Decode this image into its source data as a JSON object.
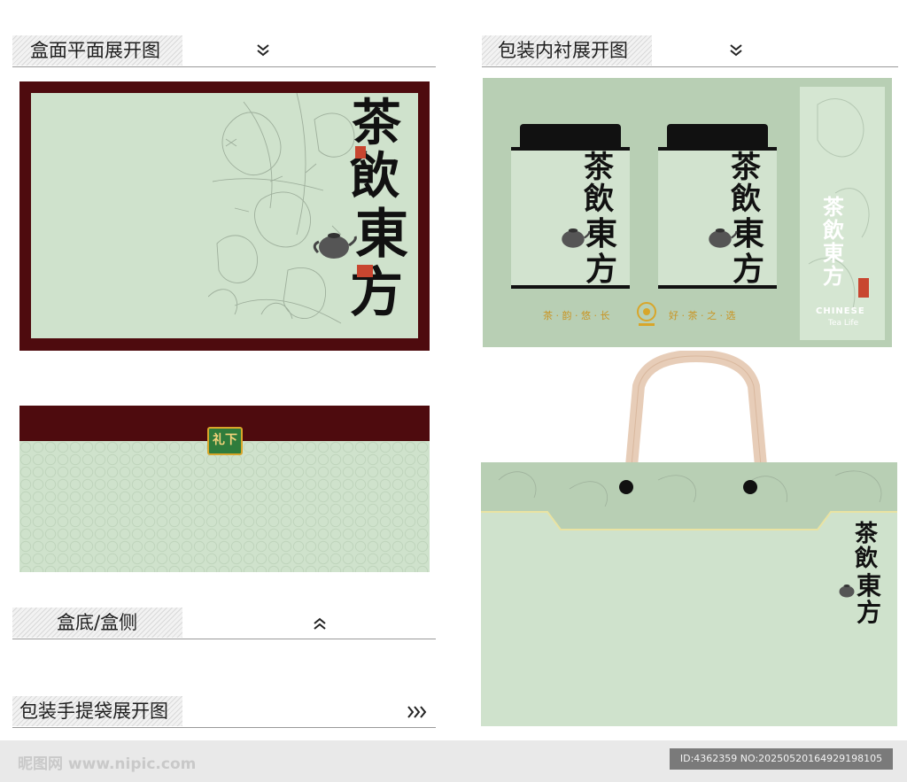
{
  "sections": {
    "box_top": {
      "title": "盒面平面展开图",
      "toggle_icon": "chevron-double-down-icon"
    },
    "box_bottom": {
      "title": "盒底/盒侧",
      "toggle_icon": "chevron-double-up-icon"
    },
    "handbag": {
      "title": "包装手提袋展开图",
      "toggle_icon": "chevron-triple-right-icon"
    },
    "liner": {
      "title": "包装内衬展开图",
      "toggle_icon": "chevron-double-down-icon"
    }
  },
  "brand": {
    "chars": [
      "茶",
      "飲",
      "東",
      "方"
    ],
    "english_1": "CHINESE",
    "english_2": "Tea Life"
  },
  "liner": {
    "slogan_left": "茶 · 韵 · 悠 · 长",
    "slogan_right": "好 · 茶 · 之 · 选"
  },
  "bottom_badge": "礼下",
  "footer": {
    "site": "昵图网 www.nipic.com",
    "id": "ID:4362359 NO:20250520164929198105"
  },
  "colors": {
    "maroon": "#4e0b0e",
    "sage": "#cfe2cc",
    "gold": "#d8a62a"
  }
}
